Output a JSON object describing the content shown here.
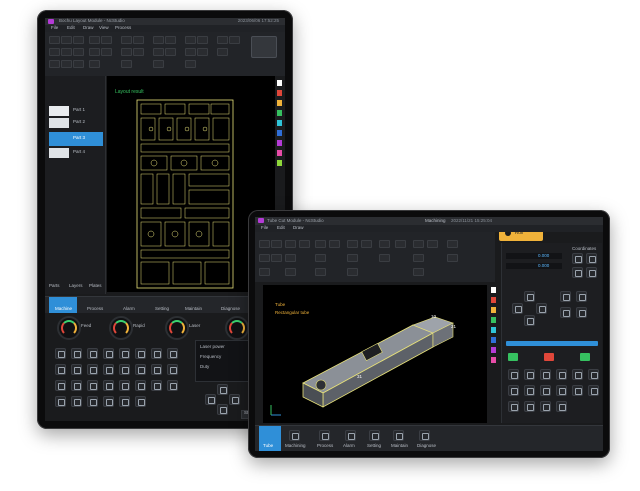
{
  "left_device": {
    "app_title": "Bochu Layout Module - NcStudio",
    "clock": "2023/06/06 17:52:25",
    "menu": [
      "File",
      "Edit",
      "Draw",
      "View",
      "Process",
      "CAM",
      "NC",
      "Help"
    ],
    "canvas_label": "Layout result",
    "tree_items": [
      "Part 1",
      "Part 2",
      "Part 3",
      "Part 4"
    ],
    "bottom_tabs": [
      "Machine",
      "Process",
      "Alarm",
      "Setting",
      "Maintain",
      "Diagnose"
    ],
    "side_tabs": [
      "Parts",
      "Layers",
      "Plates"
    ],
    "gauges": [
      "Feed",
      "Rapid",
      "Laser",
      "Gas"
    ],
    "status_labels": [
      "Laser power",
      "Frequency",
      "Duty"
    ],
    "status_values": [
      "0.000",
      "0.000",
      "0.000",
      "0.000"
    ],
    "buttons_bottom": [
      "Start",
      "Pause",
      "Stop"
    ]
  },
  "right_device": {
    "app_title": "Tube Cut Module - NcStudio",
    "tab_active": "Machining",
    "clock": "2022/11/21 15:25:04",
    "top_right_button": "Run",
    "menu": [
      "File",
      "Edit",
      "Draw",
      "Tube",
      "Process",
      "View",
      "Help"
    ],
    "canvas_title": "Tube",
    "canvas_subtitle": "Rectangular tube",
    "part_label_1": "10",
    "part_label_2": "21",
    "part_label_3": "31",
    "right_panel_title": "Coordinates",
    "right_values": [
      "0.000",
      "0.000",
      "0.000",
      "0.000"
    ],
    "bottom_tabs": [
      "Tube",
      "Machining",
      "Process",
      "Alarm",
      "Setting",
      "Maintain",
      "Diagnose"
    ]
  },
  "colors": {
    "canvas_bg": "#000000",
    "part_stroke": "#e8e27a",
    "accent_yellow": "#f0b23a",
    "accent_blue": "#2f8fd8",
    "accent_green": "#36c160",
    "accent_red": "#e0473a"
  }
}
